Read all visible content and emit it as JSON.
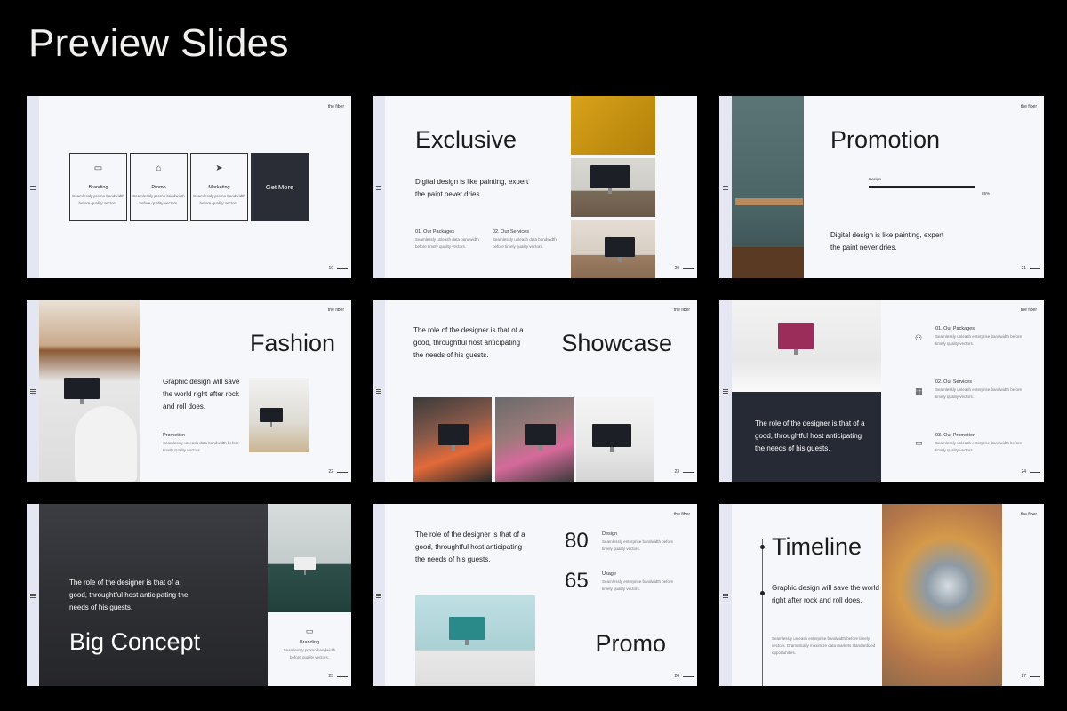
{
  "header": {
    "title": "Preview Slides"
  },
  "brand": "the fiber",
  "slides": [
    {
      "page": "19",
      "cards": [
        {
          "title": "Branding",
          "desc": "Seamlessly promo bandwidth before quality vectors.",
          "icon": "folder-icon"
        },
        {
          "title": "Promo",
          "desc": "Seamlessly promo bandwidth before quality vectors.",
          "icon": "gift-icon"
        },
        {
          "title": "Marketing",
          "desc": "Seamlessly promo bandwidth before quality vectors.",
          "icon": "paper-plane-icon"
        }
      ],
      "cta": "Get More"
    },
    {
      "page": "20",
      "title": "Exclusive",
      "text": "Digital design is like painting, expert the paint never dries.",
      "items": [
        {
          "title": "01. Our Packages",
          "desc": "Seamlessly unleash data bandwidth before timely quality vectors."
        },
        {
          "title": "02. Our Services",
          "desc": "Seamlessly unleash data bandwidth before timely quality vectors."
        }
      ]
    },
    {
      "page": "21",
      "title": "Promotion",
      "bar_label": "Design",
      "bar_value": "85%",
      "bar_fraction": 0.85,
      "text": "Digital design is like painting, expert the paint never dries."
    },
    {
      "page": "22",
      "title": "Fashion",
      "text": "Graphic design will save the world right after rock and roll does.",
      "sub_title": "Promotion",
      "sub_desc": "Seamlessly unleash data bandwidth before timely quality vectors."
    },
    {
      "page": "23",
      "title": "Showcase",
      "text": "The role of the designer is that of a good, throughtful host anticipating the needs of his guests."
    },
    {
      "page": "24",
      "text": "The role of the designer is that of a good, throughtful host anticipating the needs of his guests.",
      "items": [
        {
          "title": "01. Our Packages",
          "desc": "Seamlessly unleash enterprise bandwidth before timely quality vectors.",
          "icon": "people-icon"
        },
        {
          "title": "02. Our Services",
          "desc": "Seamlessly unleash enterprise bandwidth before timely quality vectors.",
          "icon": "calendar-icon"
        },
        {
          "title": "03. Our Promotion",
          "desc": "Seamlessly unleash enterprise bandwidth before timely quality vectors.",
          "icon": "folder-icon"
        }
      ]
    },
    {
      "page": "25",
      "title": "Big Concept",
      "text": "The role of the designer is that of a good, throughtful host anticipating the needs of his guests.",
      "card_title": "Branding",
      "card_desc": "Seamlessly promo bandwidth before quality vectors."
    },
    {
      "page": "26",
      "title": "Promo",
      "text": "The role of the designer is that of a good, throughtful host anticipating the needs of his guests.",
      "stats": [
        {
          "value": "80",
          "label": "Design",
          "desc": "Seamlessly enterprise bandwidth before timely quality vectors."
        },
        {
          "value": "65",
          "label": "Usage",
          "desc": "Seamlessly enterprise bandwidth before timely quality vectors."
        }
      ]
    },
    {
      "page": "27",
      "title": "Timeline",
      "text": "Graphic design will save the world right after rock and roll does.",
      "desc": "Seamlessly unleash enterprise bandwidth before timely vectors. Dramatically maximize data markets standardized opportunities."
    }
  ]
}
